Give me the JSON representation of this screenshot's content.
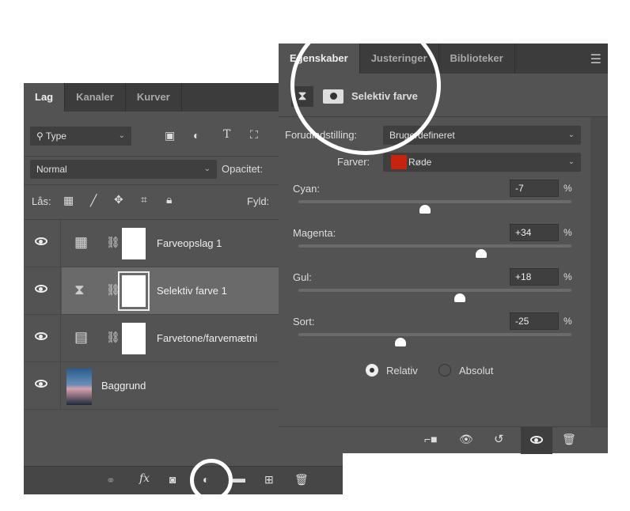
{
  "layers_panel": {
    "tabs": [
      "Lag",
      "Kanaler",
      "Kurver"
    ],
    "filter": {
      "label": "Type"
    },
    "blend_mode": "Normal",
    "opacity_label": "Opacitet:",
    "lock_label": "Lås:",
    "fill_label": "Fyld:",
    "layers": [
      {
        "name": "Farveopslag 1",
        "icon": "grid-icon"
      },
      {
        "name": "Selektiv farve 1",
        "icon": "selective-color-icon",
        "selected": true
      },
      {
        "name": "Farvetone/farvemætni",
        "icon": "hue-saturation-icon"
      },
      {
        "name": "Baggrund",
        "icon": "image-thumbnail"
      }
    ]
  },
  "properties_panel": {
    "tabs": [
      "Egenskaber",
      "Justeringer",
      "Biblioteker"
    ],
    "title": "Selektiv farve",
    "preset_label": "Forudindstilling:",
    "preset_value": "Brugerdefineret",
    "colors_label": "Farver:",
    "colors_value": "Røde",
    "swatch_color": "#c8230f",
    "sliders": [
      {
        "label": "Cyan:",
        "value": "-7",
        "num": -7
      },
      {
        "label": "Magenta:",
        "value": "+34",
        "num": 34
      },
      {
        "label": "Gul:",
        "value": "+18",
        "num": 18
      },
      {
        "label": "Sort:",
        "value": "-25",
        "num": -25
      }
    ],
    "percent": "%",
    "method": {
      "relative": "Relativ",
      "absolute": "Absolut",
      "selected": "relative"
    }
  }
}
